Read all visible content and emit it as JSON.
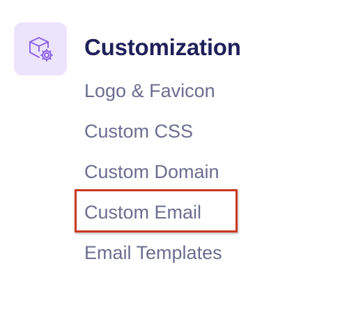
{
  "section": {
    "icon": "cube-gear-icon",
    "title": "Customization"
  },
  "menu": {
    "items": [
      {
        "label": "Logo & Favicon"
      },
      {
        "label": "Custom CSS"
      },
      {
        "label": "Custom Domain"
      },
      {
        "label": "Custom Email",
        "highlighted": true
      },
      {
        "label": "Email Templates"
      }
    ]
  },
  "colors": {
    "title": "#1f1f5a",
    "item": "#6b6d8f",
    "icon_tile_bg": "#ece3fd",
    "icon_stroke": "#8a63e8",
    "highlight": "#c9381f"
  }
}
